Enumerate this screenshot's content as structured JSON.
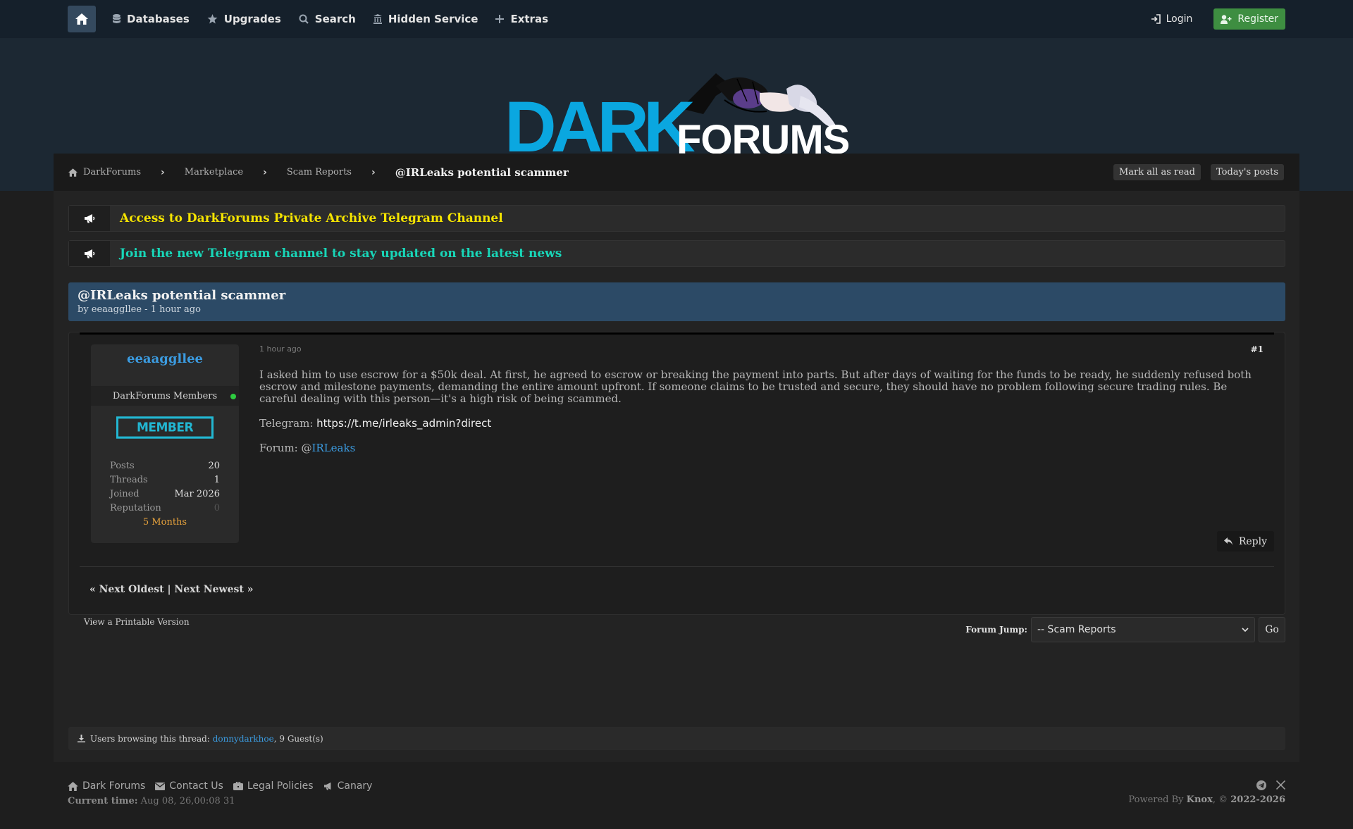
{
  "nav": {
    "items": [
      {
        "label": "Databases",
        "icon": "database-icon"
      },
      {
        "label": "Upgrades",
        "icon": "star-icon"
      },
      {
        "label": "Search",
        "icon": "search-icon"
      },
      {
        "label": "Hidden Service",
        "icon": "building-icon"
      },
      {
        "label": "Extras",
        "icon": "plus-icon"
      }
    ],
    "login": "Login",
    "register": "Register"
  },
  "logo": {
    "word1": "DARK",
    "word2": "FORUMS"
  },
  "breadcrumb": {
    "items": [
      "DarkForums",
      "Marketplace",
      "Scam Reports"
    ],
    "current": "@IRLeaks potential scammer",
    "mark_read": "Mark all as read",
    "todays_posts": "Today's posts"
  },
  "announcements": [
    {
      "text": "Access to DarkForums Private Archive Telegram Channel",
      "color": "#f5e400"
    },
    {
      "text": "Join the new Telegram channel to stay updated on the latest news",
      "color": "#18d6b8"
    }
  ],
  "thread": {
    "title": "@IRLeaks potential scammer",
    "subtitle": "by eeaaggllee - 1 hour ago"
  },
  "post": {
    "author": "eeaaggllee",
    "group": "DarkForums Members",
    "badge": "MEMBER",
    "stats": [
      {
        "k": "Posts",
        "v": "20"
      },
      {
        "k": "Threads",
        "v": "1"
      },
      {
        "k": "Joined",
        "v": "Mar 2026"
      },
      {
        "k": "Reputation",
        "v": "0"
      }
    ],
    "tenure": "5 Months",
    "date": "1 hour ago",
    "number": "#1",
    "body": "I asked him to use escrow for a $50k deal. At first, he agreed to escrow or breaking the payment into parts. But after days of waiting for the funds to be ready, he suddenly refused both escrow and milestone payments, demanding the entire amount upfront. If someone claims to be trusted and secure, they should have no problem following secure trading rules. Be careful dealing with this person—it's a high risk of being scammed.",
    "telegram_label": "Telegram: ",
    "telegram_link": "https://t.me/irleaks_admin?direct",
    "forum_label": "Forum: @",
    "forum_link": "IRLeaks",
    "reply": "Reply"
  },
  "pager": {
    "text": "« Next Oldest | Next Newest »"
  },
  "printable": "View a Printable Version",
  "forum_jump": {
    "label": "Forum Jump:",
    "selected": "-- Scam Reports",
    "go": "Go"
  },
  "browsing": {
    "label": "Users browsing this thread:",
    "user": "donnydarkhoe",
    "guests": ", 9 Guest(s)"
  },
  "footer": {
    "links": [
      "Dark Forums",
      "Contact Us",
      "Legal Policies",
      "Canary"
    ],
    "time_label": "Current time:",
    "time_value": "Aug 08, 26,00:08 31",
    "powered_prefix": "Powered By ",
    "powered_name": "Knox",
    "powered_suffix": ", © ",
    "years": "2022-2026"
  }
}
